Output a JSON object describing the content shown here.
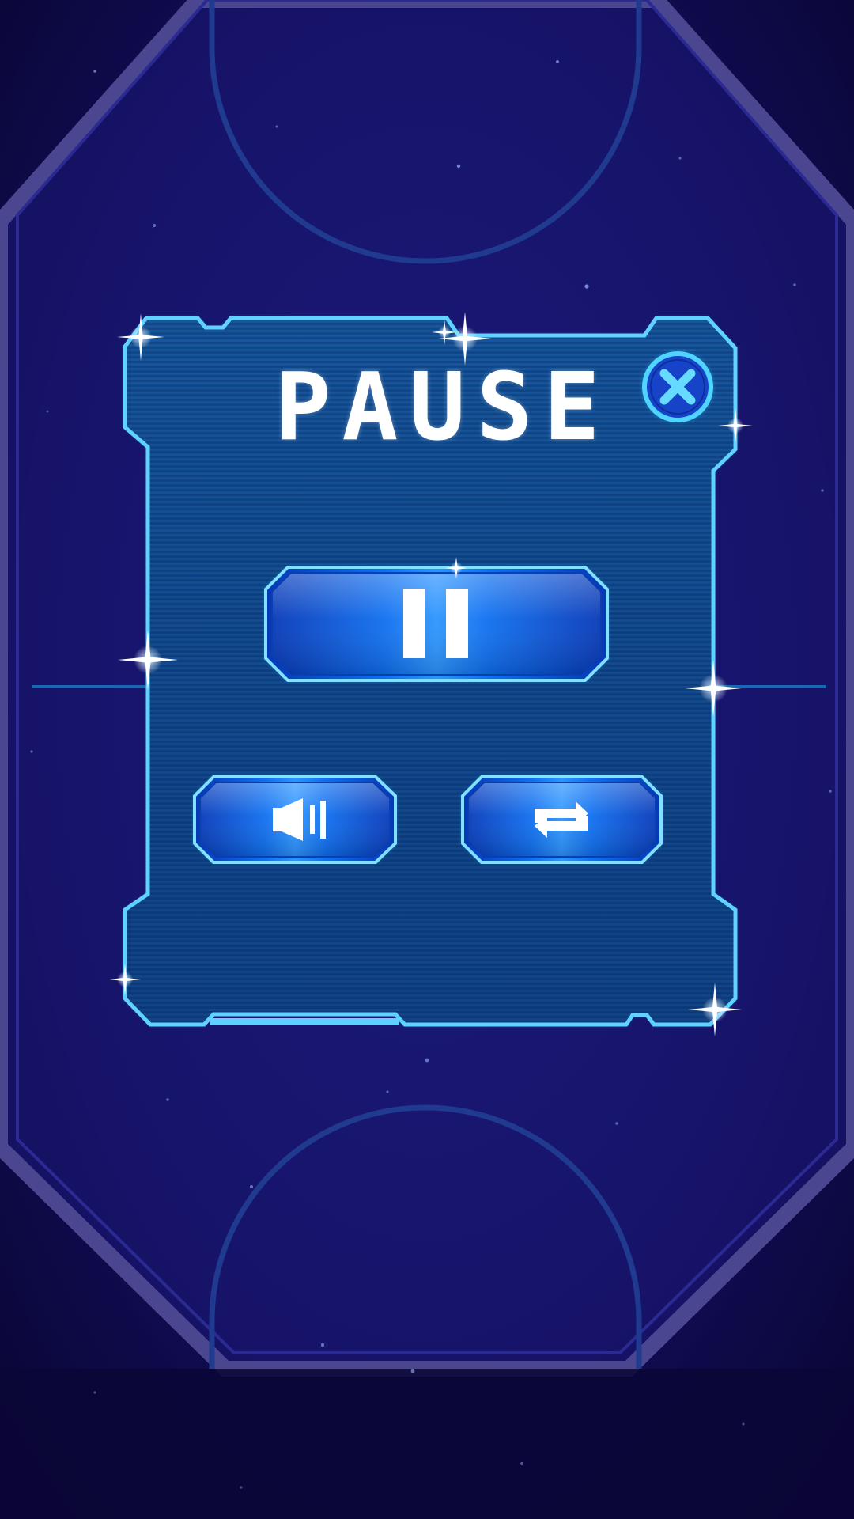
{
  "screen": {
    "title": "PAUSE"
  },
  "buttons": {
    "close": {
      "icon": "close-x-icon"
    },
    "resume": {
      "icon": "pause-bars-icon"
    },
    "sound": {
      "icon": "speaker-volume-icon"
    },
    "restart": {
      "icon": "repeat-arrows-icon"
    }
  },
  "colors": {
    "background": "#0a0636",
    "rink_border": "#3e3a8a",
    "panel_fill": "#124d96",
    "panel_glow": "#29b6ff",
    "button_fill": "#0a62e8",
    "close_fill": "#1743c9",
    "close_ring": "#36c8ff"
  }
}
